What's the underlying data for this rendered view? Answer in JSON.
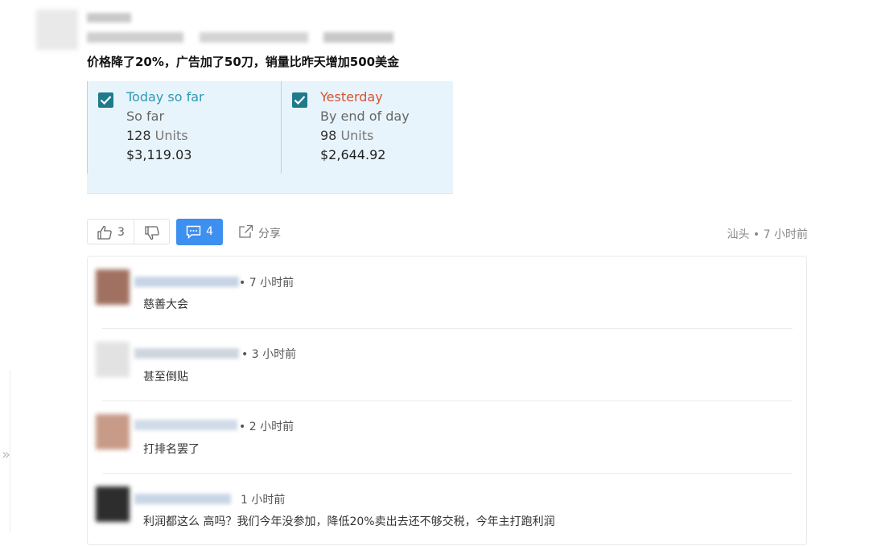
{
  "post": {
    "title": "价格降了20%，广告加了50刀，销量比昨天增加500美金"
  },
  "sales_card": {
    "today": {
      "title": "Today so far",
      "subtitle": "So far",
      "units_count": "128",
      "units_label": "Units",
      "amount": "$3,119.03",
      "checked": true,
      "color": "#2f9ab0"
    },
    "yesterday": {
      "title": "Yesterday",
      "subtitle": "By end of day",
      "units_count": "98",
      "units_label": "Units",
      "amount": "$2,644.92",
      "checked": true,
      "color": "#d9502e"
    },
    "background": "#e8f4fc",
    "checkbox_color": "#1f7a8c"
  },
  "actions": {
    "like_count": "3",
    "comment_count": "4",
    "share_label": "分享",
    "location_time": "汕头 • 7 小时前",
    "comment_button_color": "#3d8ff0",
    "icons": [
      "thumbs-up-icon",
      "thumbs-down-icon",
      "comment-icon",
      "share-icon"
    ]
  },
  "comments": [
    {
      "time": "• 7 小时前",
      "text": "慈善大会"
    },
    {
      "time": "• 3 小时前",
      "text": "甚至倒贴"
    },
    {
      "time": "• 2 小时前",
      "text": "打排名罢了"
    },
    {
      "time": "1 小时前",
      "text": "利润都这么 高吗？我们今年没参加，降低20%卖出去还不够交税，今年主打跑利润"
    }
  ]
}
